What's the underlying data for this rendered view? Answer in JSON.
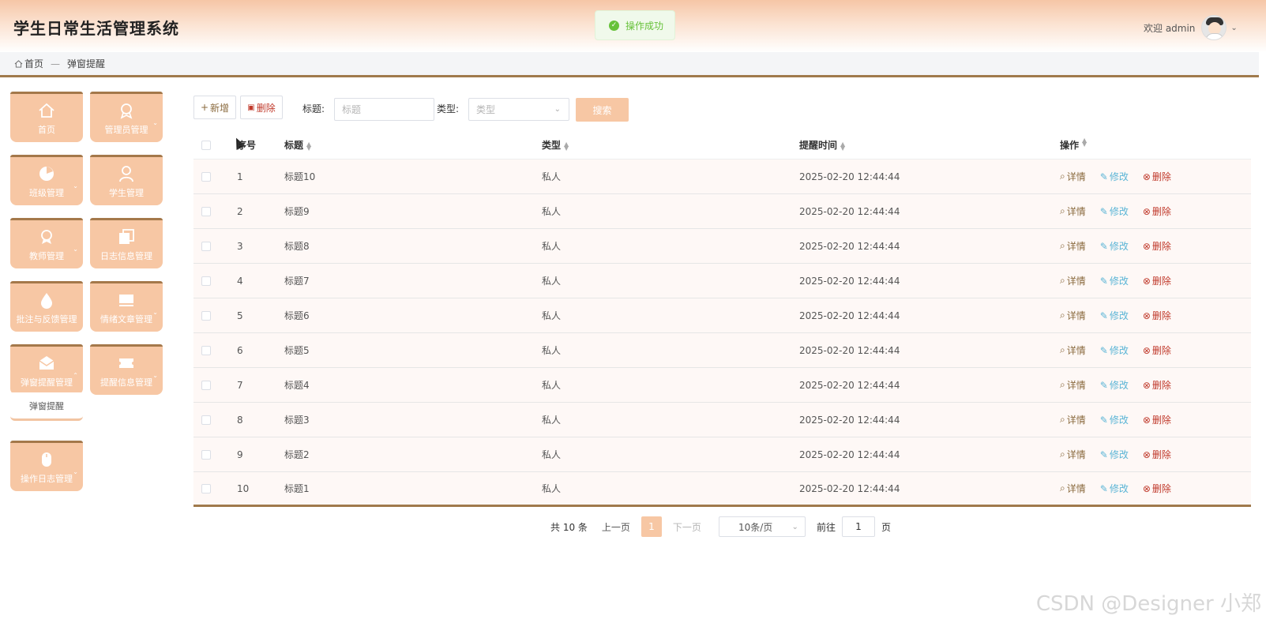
{
  "header": {
    "title": "学生日常生活管理系统",
    "welcome": "欢迎 admin",
    "toast": "操作成功"
  },
  "breadcrumb": {
    "home": "首页",
    "sep": "—",
    "current": "弹窗提醒"
  },
  "sidebar": {
    "items": [
      {
        "label": "首页",
        "icon": "home-icon"
      },
      {
        "label": "管理员管理",
        "icon": "admin-badge-icon"
      },
      {
        "label": "班级管理",
        "icon": "pie-icon"
      },
      {
        "label": "学生管理",
        "icon": "person-icon"
      },
      {
        "label": "教师管理",
        "icon": "teacher-badge-icon"
      },
      {
        "label": "日志信息管理",
        "icon": "copy-icon"
      },
      {
        "label": "批注与反馈管理",
        "icon": "drop-icon"
      },
      {
        "label": "情绪文章管理",
        "icon": "monitor-icon"
      },
      {
        "label": "弹窗提醒管理",
        "icon": "envelope-icon"
      },
      {
        "label": "提醒信息管理",
        "icon": "ticket-icon"
      },
      {
        "label": "操作日志管理",
        "icon": "mouse-icon"
      }
    ],
    "sub_item": "弹窗提醒"
  },
  "toolbar": {
    "add": "新增",
    "delete": "删除",
    "title_label": "标题:",
    "title_placeholder": "标题",
    "type_label": "类型:",
    "type_placeholder": "类型",
    "search": "搜索"
  },
  "table": {
    "headers": {
      "index": "序号",
      "title": "标题",
      "type": "类型",
      "time": "提醒时间",
      "ops": "操作"
    },
    "ops": {
      "detail": "详情",
      "edit": "修改",
      "delete": "删除"
    },
    "rows": [
      {
        "index": "1",
        "title": "标题10",
        "type": "私人",
        "time": "2025-02-20 12:44:44"
      },
      {
        "index": "2",
        "title": "标题9",
        "type": "私人",
        "time": "2025-02-20 12:44:44"
      },
      {
        "index": "3",
        "title": "标题8",
        "type": "私人",
        "time": "2025-02-20 12:44:44"
      },
      {
        "index": "4",
        "title": "标题7",
        "type": "私人",
        "time": "2025-02-20 12:44:44"
      },
      {
        "index": "5",
        "title": "标题6",
        "type": "私人",
        "time": "2025-02-20 12:44:44"
      },
      {
        "index": "6",
        "title": "标题5",
        "type": "私人",
        "time": "2025-02-20 12:44:44"
      },
      {
        "index": "7",
        "title": "标题4",
        "type": "私人",
        "time": "2025-02-20 12:44:44"
      },
      {
        "index": "8",
        "title": "标题3",
        "type": "私人",
        "time": "2025-02-20 12:44:44"
      },
      {
        "index": "9",
        "title": "标题2",
        "type": "私人",
        "time": "2025-02-20 12:44:44"
      },
      {
        "index": "10",
        "title": "标题1",
        "type": "私人",
        "time": "2025-02-20 12:44:44"
      }
    ]
  },
  "pager": {
    "total": "共 10 条",
    "prev": "上一页",
    "current": "1",
    "next": "下一页",
    "size": "10条/页",
    "goto": "前往",
    "goto_value": "1",
    "page_unit": "页"
  },
  "watermark": "CSDN @Designer 小郑",
  "colors": {
    "accent": "#f7c7a4",
    "brand_dark": "#a07a4c",
    "success": "#67c23a",
    "danger": "#c0392b",
    "edit": "#5bb5d6"
  }
}
